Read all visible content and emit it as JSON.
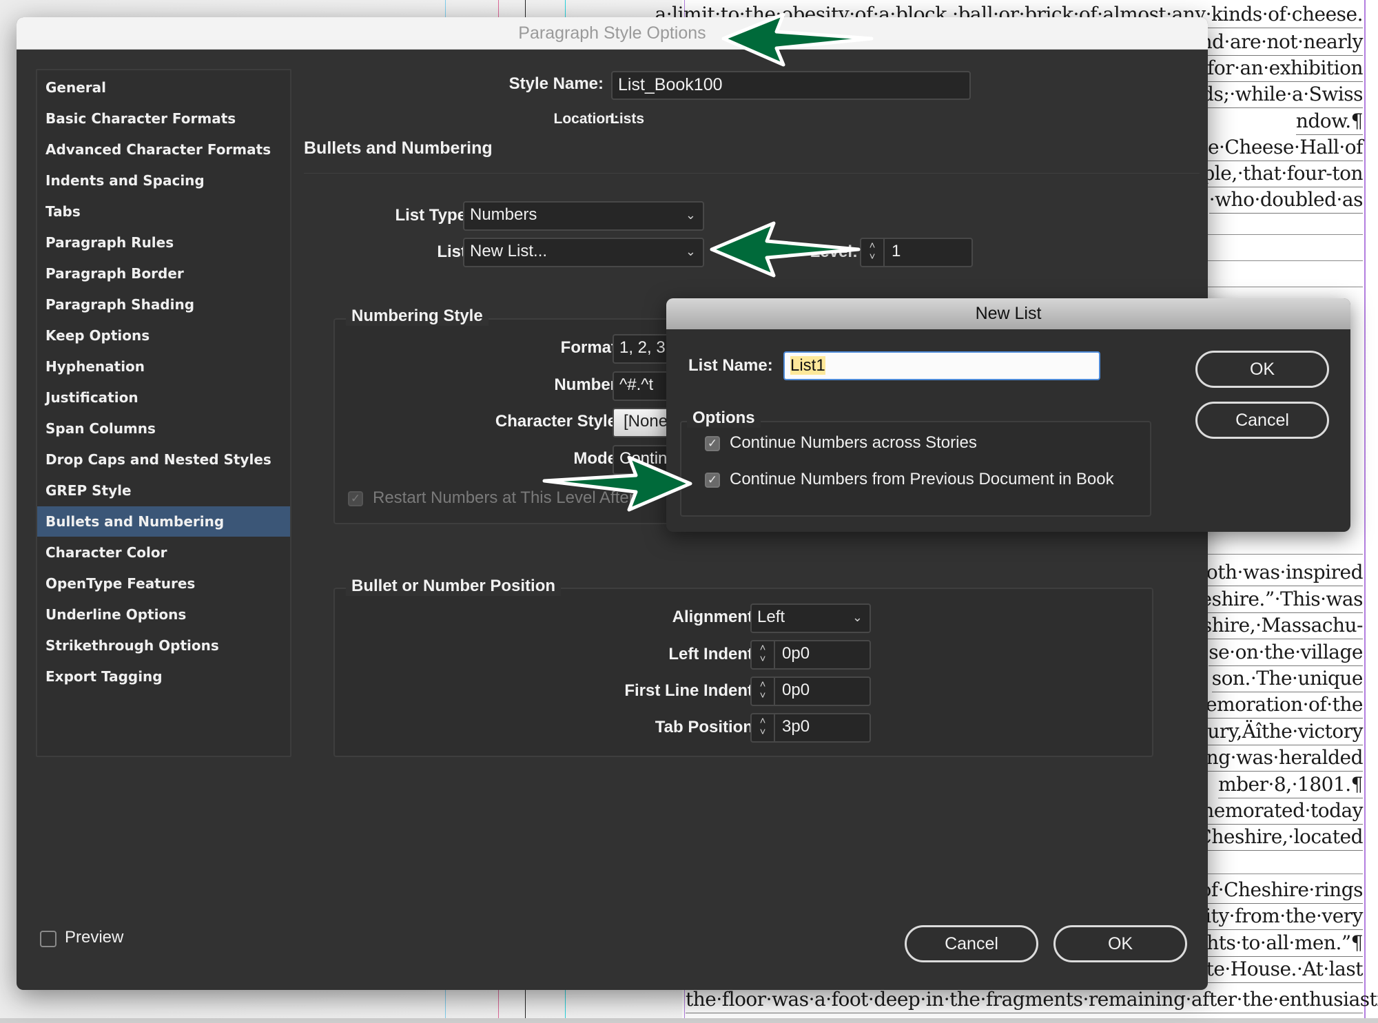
{
  "background_document": {
    "lines_top": [
      "a·limit·to·the·obesity·of·a·block,·ball·or·brick·of·almost·any·kinds·of·cheese.",
      "nd·are·not·nearly",
      "for·an·exhibition",
      "ds;·while·a·Swiss",
      "ndow.¶",
      "e·Cheese·Hall·of",
      "ple,·that·four-ton",
      "·who·doubled·as"
    ],
    "lines_middle": [
      "oth·was·inspired",
      "eshire.”·This·was",
      "shire,·Massachu-",
      "se·on·the·village",
      "son.·The·unique",
      "nemoration·of·the",
      "ury,Äîthe·victory",
      "ing·was·heralded",
      "mber·8,·1801.¶",
      "nemorated·today",
      "Cheshire,·located"
    ],
    "lines_bottom": [
      "of·Cheshire·rings",
      "ity·from·the·very",
      "rights·to·all·men.”¶",
      "te·House.·At·last",
      "the·floor·was·a·foot·deep·in·the·fragments·remaining·after·the·enthusiastic"
    ]
  },
  "main_dialog": {
    "title": "Paragraph Style Options",
    "sidebar": {
      "selected_index": 14,
      "items": [
        "General",
        "Basic Character Formats",
        "Advanced Character Formats",
        "Indents and Spacing",
        "Tabs",
        "Paragraph Rules",
        "Paragraph Border",
        "Paragraph Shading",
        "Keep Options",
        "Hyphenation",
        "Justification",
        "Span Columns",
        "Drop Caps and Nested Styles",
        "GREP Style",
        "Bullets and Numbering",
        "Character Color",
        "OpenType Features",
        "Underline Options",
        "Strikethrough Options",
        "Export Tagging"
      ]
    },
    "style_name": {
      "label": "Style Name:",
      "value": "List_Book100"
    },
    "location": {
      "label": "Location:",
      "value": "Lists"
    },
    "section_title": "Bullets and Numbering",
    "list_type": {
      "label": "List Type:",
      "value": "Numbers"
    },
    "list": {
      "label": "List:",
      "value": "New List..."
    },
    "level": {
      "label": "Level:",
      "value": "1"
    },
    "numbering_style": {
      "title": "Numbering Style",
      "format": {
        "label": "Format:",
        "value": "1, 2, 3"
      },
      "number": {
        "label": "Number:",
        "value": "^#.^t"
      },
      "character_style": {
        "label": "Character Style:",
        "value": "[None]"
      },
      "mode": {
        "label": "Mode:",
        "value": "Continue"
      },
      "restart": {
        "label": "Restart Numbers at This Level After",
        "checked": true,
        "disabled": true
      }
    },
    "position": {
      "title": "Bullet or Number Position",
      "alignment": {
        "label": "Alignment:",
        "value": "Left"
      },
      "left_indent": {
        "label": "Left Indent:",
        "value": "0p0"
      },
      "first_line_indent": {
        "label": "First Line Indent:",
        "value": "0p0"
      },
      "tab_position": {
        "label": "Tab Position:",
        "value": "3p0"
      }
    },
    "preview": {
      "label": "Preview",
      "checked": false
    },
    "cancel_label": "Cancel",
    "ok_label": "OK"
  },
  "new_list_dialog": {
    "title": "New List",
    "list_name": {
      "label": "List Name:",
      "value": "List1"
    },
    "options_title": "Options",
    "options": [
      {
        "label": "Continue Numbers across Stories",
        "checked": true
      },
      {
        "label": "Continue Numbers from Previous Document in Book",
        "checked": true
      }
    ],
    "ok_label": "OK",
    "cancel_label": "Cancel"
  },
  "icons": {
    "chevron": "⌄",
    "spin_up": "˄",
    "spin_down": "˅",
    "check": "✓"
  },
  "colors": {
    "dialog_bg": "#323232",
    "selected_item": "#3b5677",
    "annotation_arrow": "#006a3a",
    "guide_margin": "#b37ee0"
  }
}
